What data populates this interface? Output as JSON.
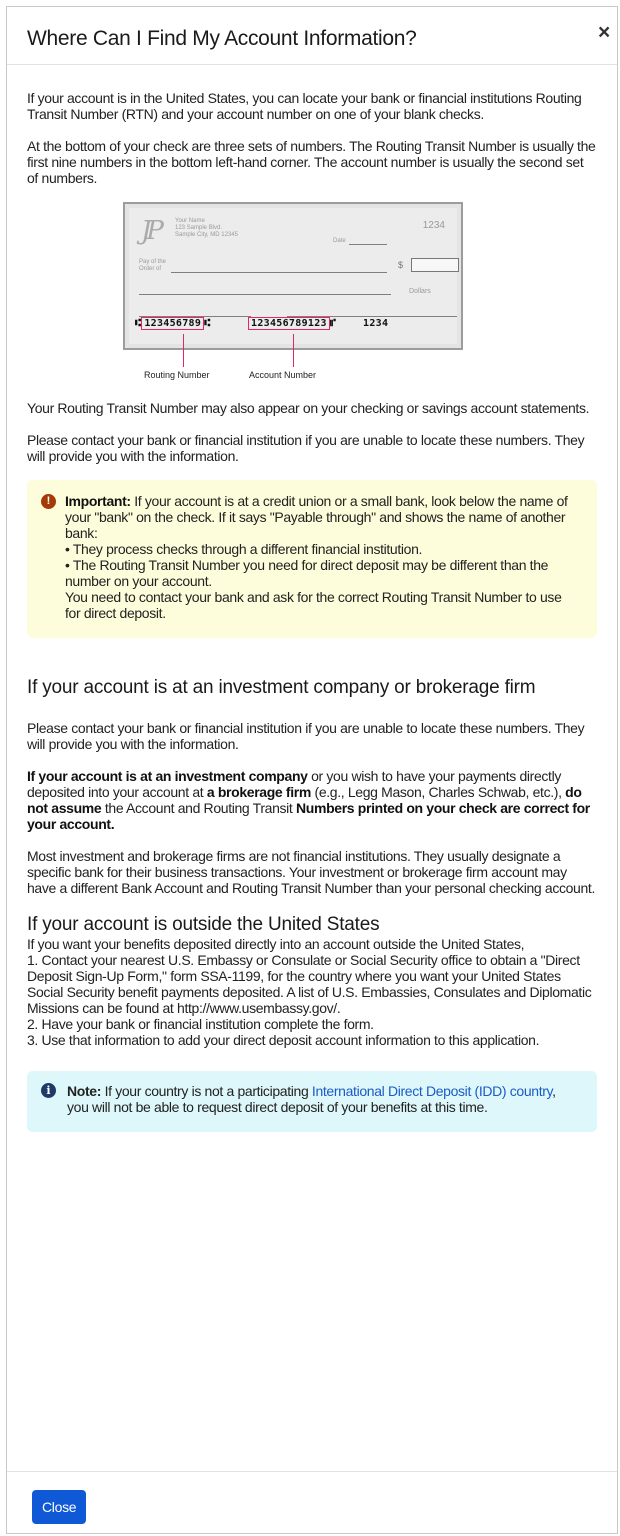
{
  "header": {
    "title": "Where Can I Find My Account Information?",
    "close_icon": "×"
  },
  "intro": [
    "If your account is in the United States, you can locate your bank or financial institutions Routing Transit Number (RTN) and your account number on one of your blank checks.",
    "At the bottom of your check are three sets of numbers. The Routing Transit Number is usually the first nine numbers in the bottom left-hand corner. The account number is usually the second set of numbers."
  ],
  "check": {
    "name": "Your Name",
    "address1": "123 Sample Blvd.",
    "address2": "Sample City, MD 12345",
    "check_number": "1234",
    "date_label": "Date",
    "pay_label_1": "Pay of the",
    "pay_label_2": "Order of",
    "dollar_sign": "$",
    "dollars_label": "Dollars",
    "routing_micr": "123456789",
    "account_micr": "123456789123",
    "check_micr": "1234",
    "routing_caption": "Routing Number",
    "account_caption": "Account Number"
  },
  "after_check": [
    "Your Routing Transit Number may also appear on your checking or savings account statements.",
    "Please contact your bank or financial institution if you are unable to locate these numbers. They will provide you with the information."
  ],
  "warning": {
    "icon": "warning-icon",
    "label": "Important:",
    "lead": " If your account is at a credit union or a small bank, look below the name of your \"bank\" on the check. If it says \"Payable through\" and shows the name of another bank:",
    "bullet1": "• They process checks through a different financial institution.",
    "bullet2": "• The Routing Transit Number you need for direct deposit may be different than the number on your account.",
    "closing": "You need to contact your bank and ask for the correct Routing Transit Number to use for direct deposit."
  },
  "investment": {
    "heading": "If your account is at an investment company or brokerage firm",
    "p1": "Please contact your bank or financial institution if you are unable to locate these numbers. They will provide you with the information.",
    "p2_b1": "If your account is at an investment company",
    "p2_t1": " or you wish to have your payments directly deposited into your account at ",
    "p2_b2": "a brokerage firm",
    "p2_t2": " (e.g., Legg Mason, Charles Schwab, etc.), ",
    "p2_b3": "do not assume",
    "p2_t3": " the Account and Routing Transit ",
    "p2_b4": "Numbers printed on your check are correct for your account.",
    "p3": "Most investment and brokerage firms are not financial institutions. They usually designate a specific bank for their business transactions. Your investment or brokerage firm account may have a different Bank Account and Routing Transit Number than your personal checking account."
  },
  "outside": {
    "heading": "If your account is outside the United States",
    "intro": "If you want your benefits deposited directly into an account outside the United States,",
    "step1": "1. Contact your nearest U.S. Embassy or Consulate or Social Security office to obtain a \"Direct Deposit Sign-Up Form,\" form SSA-1199, for the country where you want your United States Social Security benefit payments deposited. A list of U.S. Embassies, Consulates and Diplomatic Missions can be found at http://www.usembassy.gov/.",
    "step2": "2. Have your bank or financial institution complete the form.",
    "step3": "3. Use that information to add your direct deposit account information to this application."
  },
  "note": {
    "icon": "info-icon",
    "label": "Note:",
    "text1": " If your country is not a participating ",
    "link": "International Direct Deposit (IDD) country",
    "text2": ", you will not be able to request direct deposit of your benefits at this time."
  },
  "footer": {
    "close_button": "Close"
  },
  "colors": {
    "primary_button": "#1059d6",
    "warning_bg": "#fefddb",
    "info_bg": "#def7fa",
    "micr_highlight": "#e2266d",
    "link": "#1a5bc7"
  }
}
